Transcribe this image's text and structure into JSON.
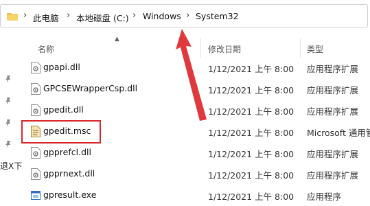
{
  "address_bar": {
    "breadcrumbs": [
      "此电脑",
      "本地磁盘 (C:)",
      "Windows",
      "System32"
    ],
    "separator": "›"
  },
  "columns": {
    "name": "名称",
    "date_modified": "修改日期",
    "type": "类型"
  },
  "gutter_text": "退X下",
  "files": [
    {
      "name": "gpapi.dll",
      "date": "1/12/2021 上午 8:00",
      "type": "应用程序扩展",
      "icon": "dll-file-icon"
    },
    {
      "name": "GPCSEWrapperCsp.dll",
      "date": "1/12/2021 上午 8:00",
      "type": "应用程序扩展",
      "icon": "dll-file-icon"
    },
    {
      "name": "gpedit.dll",
      "date": "1/12/2021 上午 8:00",
      "type": "应用程序扩展",
      "icon": "dll-file-icon"
    },
    {
      "name": "gpedit.msc",
      "date": "1/12/2021 上午 8:00",
      "type": "Microsoft 通用管",
      "icon": "msc-file-icon"
    },
    {
      "name": "gpprefcl.dll",
      "date": "1/12/2021 上午 8:00",
      "type": "应用程序扩展",
      "icon": "dll-file-icon"
    },
    {
      "name": "gpprnext.dll",
      "date": "1/12/2021 上午 8:00",
      "type": "应用程序扩展",
      "icon": "dll-file-icon"
    },
    {
      "name": "gpresult.exe",
      "date": "1/12/2021 上午 8:00",
      "type": "应用程序",
      "icon": "exe-file-icon"
    }
  ],
  "colors": {
    "highlight_border": "#d8262a",
    "arrow": "#e0393d",
    "folder": "#f2c14e"
  }
}
